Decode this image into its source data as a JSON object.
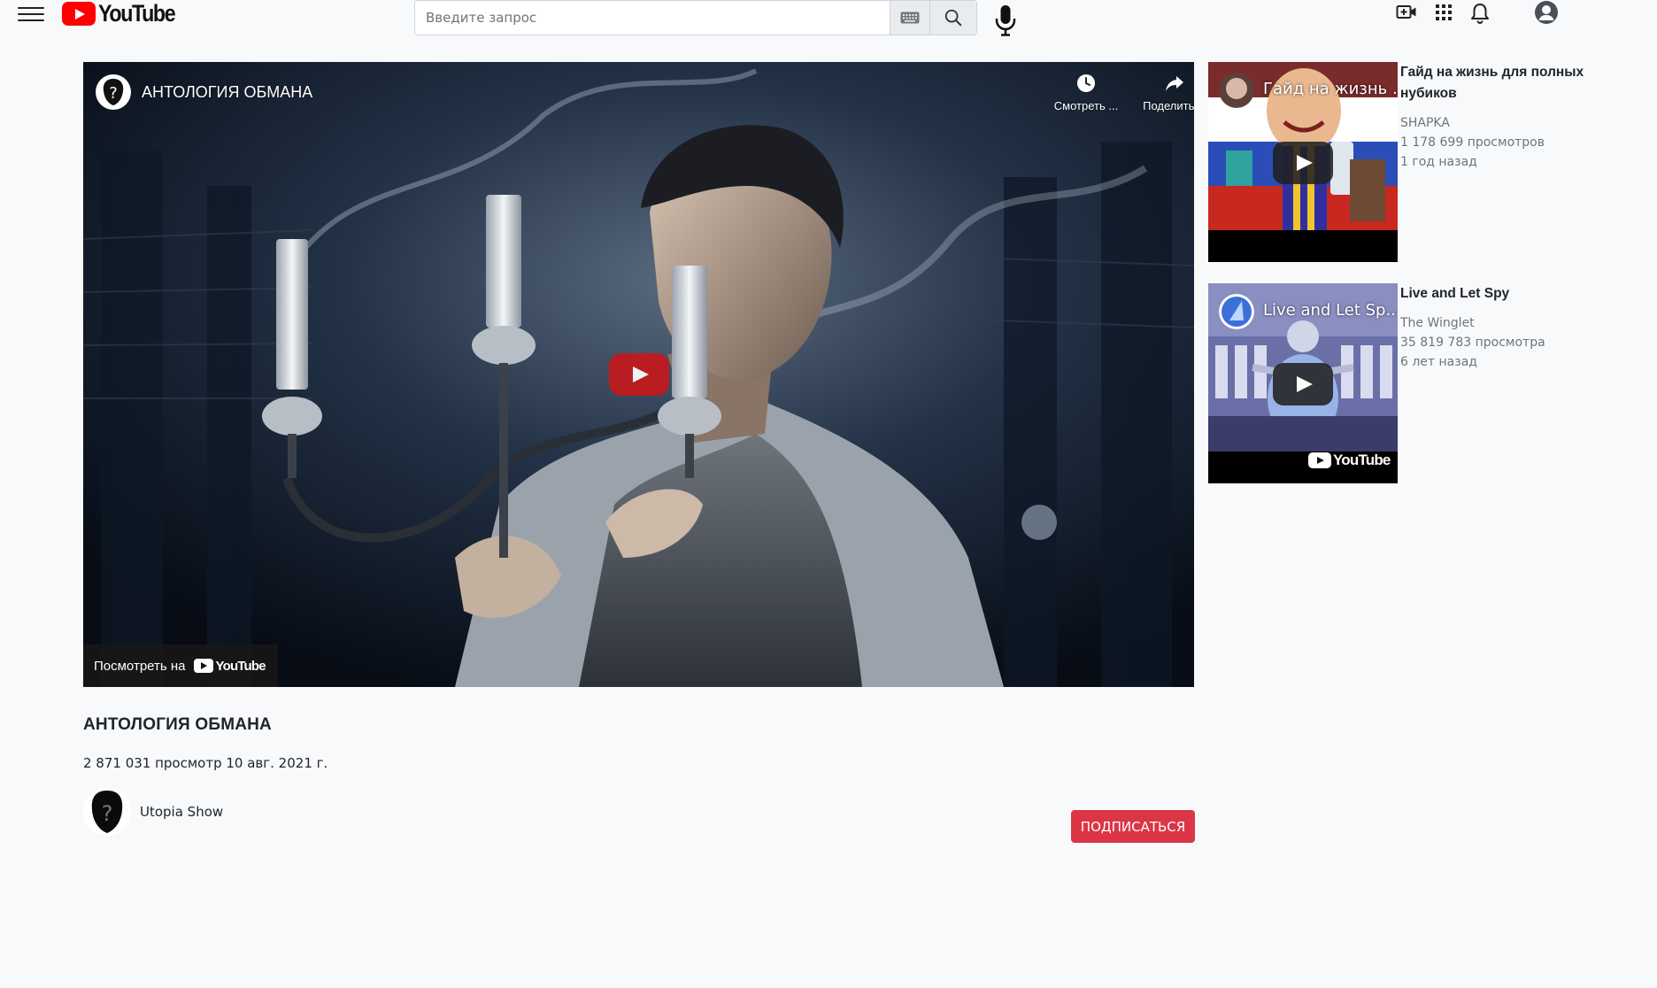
{
  "header": {
    "logo_text": "YouTube",
    "search_placeholder": "Введите запрос",
    "icons": [
      "menu-icon",
      "keyboard-icon",
      "search-icon",
      "mic-icon",
      "video-add-icon",
      "apps-icon",
      "bell-icon",
      "account-icon"
    ]
  },
  "player": {
    "title": "АНТОЛОГИЯ ОБМАНА",
    "watch_later_label": "Смотреть ...",
    "share_label": "Поделиться",
    "watch_on_label": "Посмотреть на",
    "watch_on_logo": "YouTube"
  },
  "video": {
    "title": "АНТОЛОГИЯ ОБМАНА",
    "meta": "2 871 031 просмотр 10 авг. 2021 г.",
    "channel_name": "Utopia Show",
    "subscribe_label": "ПОДПИСАТЬСЯ"
  },
  "related": [
    {
      "thumb_title": "Гайд на жизнь ...",
      "title": "Гайд на жизнь для полных нубиков",
      "channel": "SHAPKA",
      "views": "1 178 699 просмотров",
      "age": "1 год назад"
    },
    {
      "thumb_title": "Live and Let Sp...",
      "thumb_logo": "YouTube",
      "title": "Live and Let Spy",
      "channel": "The Winglet",
      "views": "35 819 783 просмотра",
      "age": "6 лет назад"
    }
  ],
  "colors": {
    "background": "#f8f9fa",
    "brand_red": "#ff0000",
    "subscribe_red": "#dc3545",
    "muted_text": "#6c757d"
  }
}
